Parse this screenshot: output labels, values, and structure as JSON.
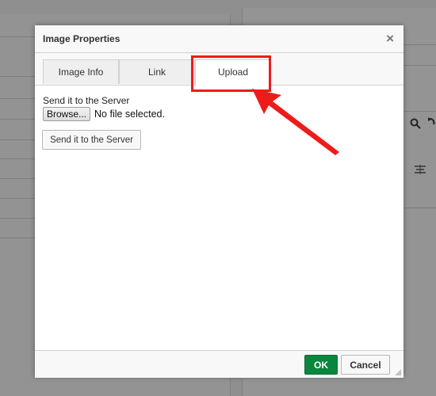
{
  "dialog": {
    "title": "Image Properties",
    "close_symbol": "×"
  },
  "tabs": [
    {
      "label": "Image Info",
      "active": false
    },
    {
      "label": "Link",
      "active": false
    },
    {
      "label": "Upload",
      "active": true
    }
  ],
  "upload": {
    "label": "Send it to the Server",
    "browse_label": "Browse...",
    "file_status": "No file selected.",
    "send_button": "Send it to the Server"
  },
  "footer": {
    "ok_label": "OK",
    "cancel_label": "Cancel"
  },
  "colors": {
    "ok_green": "#09863e",
    "annotation_red": "#ee1b1b"
  },
  "icons": {
    "close": "close-icon",
    "resize": "resize-grip-icon",
    "background_search": "search-icon",
    "background_redo": "redo-icon",
    "background_align": "align-icon"
  }
}
